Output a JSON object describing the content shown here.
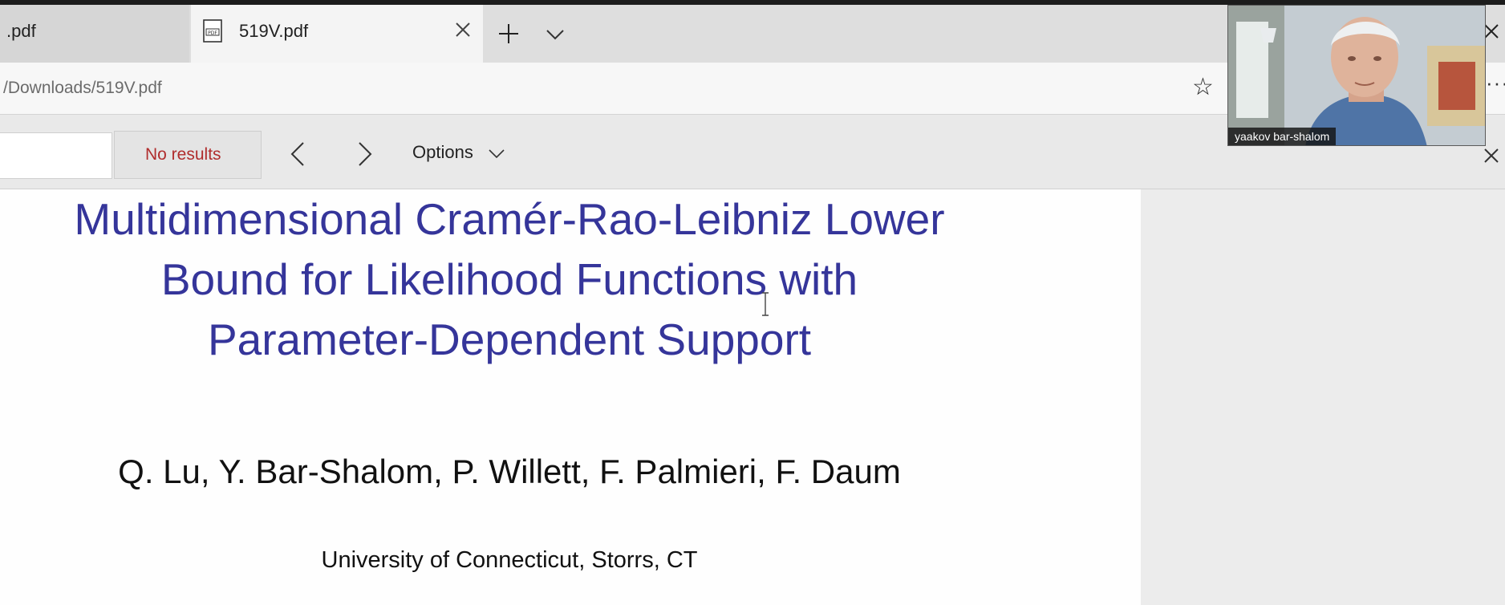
{
  "tabs": {
    "previous_label": ".pdf",
    "active_label": "519V.pdf"
  },
  "address_bar": {
    "url": "/Downloads/519V.pdf"
  },
  "find_bar": {
    "results_label": "No results",
    "options_label": "Options"
  },
  "document": {
    "title_lines": [
      "Multidimensional Cramér-Rao-Leibniz Lower",
      "Bound for Likelihood Functions with",
      "Parameter-Dependent Support"
    ],
    "authors": "Q. Lu, Y. Bar-Shalom, P. Willett,  F. Palmieri, F. Daum",
    "affiliation": "University of Connecticut, Storrs, CT"
  },
  "video": {
    "participant_name": "yaakov bar-shalom"
  },
  "colors": {
    "title_color": "#35359a",
    "no_results_color": "#b02d2d"
  },
  "icons": [
    "pdf-file-icon",
    "close-icon",
    "plus-icon",
    "chevron-down-icon",
    "star-icon",
    "more-icon",
    "chevron-left-icon",
    "chevron-right-icon",
    "text-cursor-icon"
  ]
}
